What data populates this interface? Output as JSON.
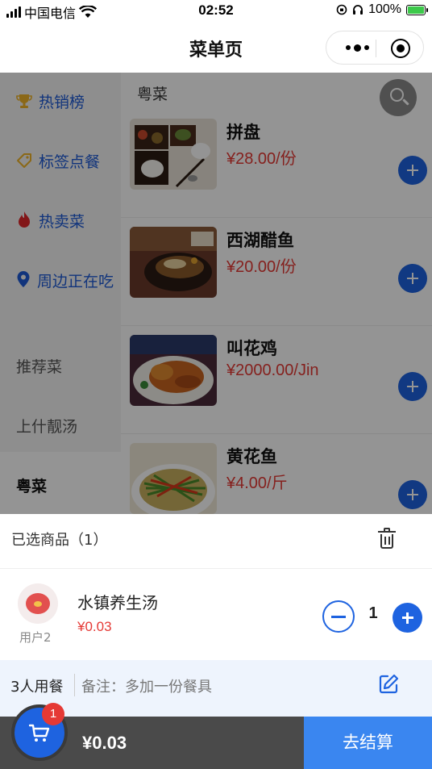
{
  "status_bar": {
    "carrier": "中国电信",
    "time": "02:52",
    "battery": "100%"
  },
  "nav": {
    "title": "菜单页"
  },
  "sidebar": {
    "items": [
      {
        "label": "热销榜",
        "icon": "trophy-icon"
      },
      {
        "label": "标签点餐",
        "icon": "tag-icon"
      },
      {
        "label": "热卖菜",
        "icon": "flame-icon"
      },
      {
        "label": "周边正在吃",
        "icon": "location-pin-icon"
      },
      {
        "label": "推荐菜"
      },
      {
        "label": "上什靓汤"
      },
      {
        "label": "粤菜"
      }
    ]
  },
  "menu": {
    "category_title": "粤菜",
    "dishes": [
      {
        "name": "拼盘",
        "price": "¥28.00/份"
      },
      {
        "name": "西湖醋鱼",
        "price": "¥20.00/份"
      },
      {
        "name": "叫花鸡",
        "price": "¥2000.00/Jin"
      },
      {
        "name": "黄花鱼",
        "price": "¥4.00/斤"
      }
    ]
  },
  "cart_panel": {
    "title": "已选商品（1）",
    "items": [
      {
        "user": "用户2",
        "name": "水镇养生汤",
        "price": "¥0.03",
        "quantity": "1"
      }
    ],
    "diners": "3人用餐",
    "remark": "备注：多加一份餐具"
  },
  "footer": {
    "badge": "1",
    "total": "¥0.03",
    "checkout_label": "去结算"
  },
  "colors": {
    "accent": "#1e63e0",
    "price": "#e53935",
    "checkout": "#3a86f0",
    "footer": "#4a4a4a"
  }
}
